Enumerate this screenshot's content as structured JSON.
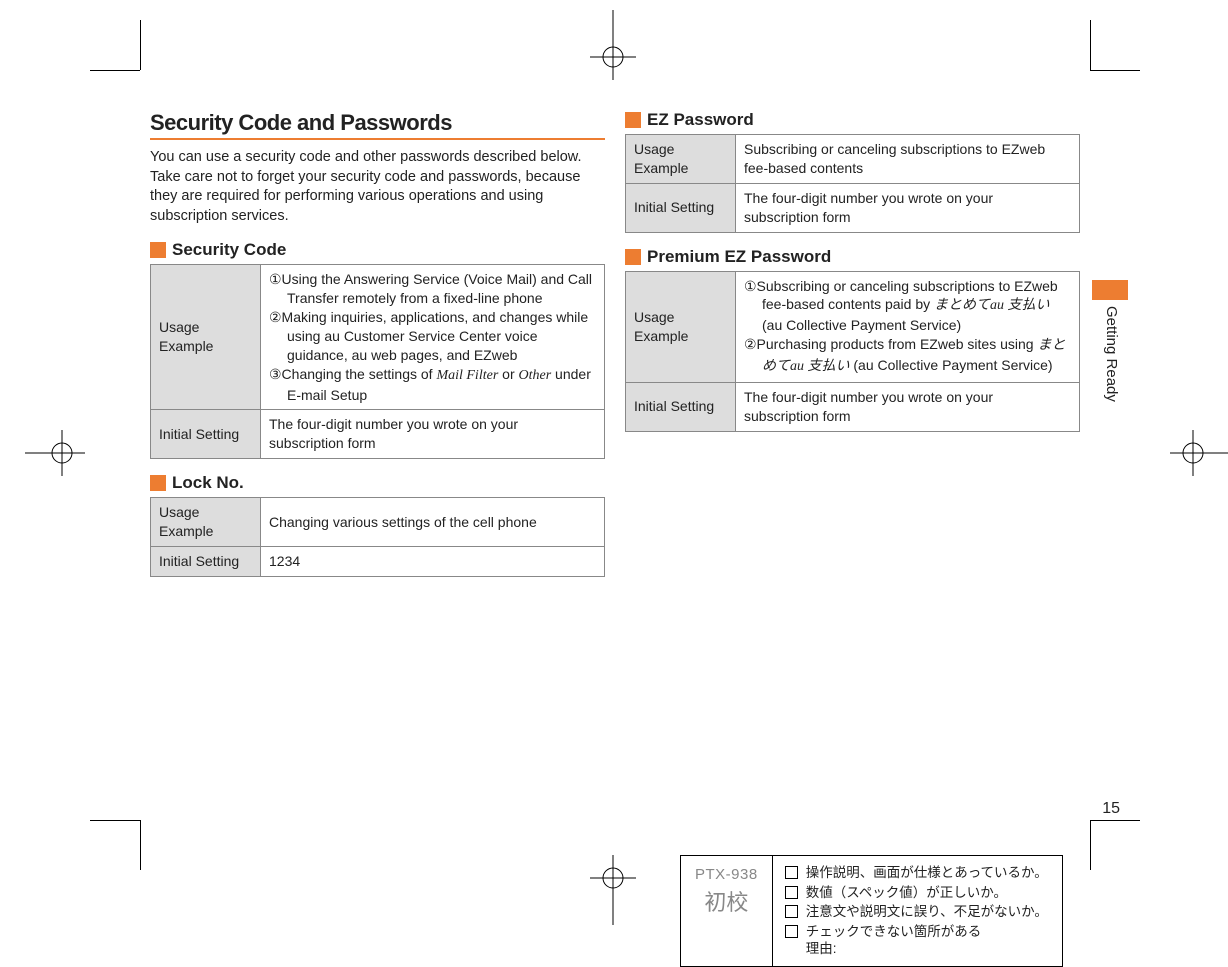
{
  "heading": "Security Code and Passwords",
  "intro": "You can use a security code and other passwords described below.\nTake care not to forget your security code and passwords, because they are required for performing various operations and using subscription services.",
  "sections": {
    "securityCode": {
      "title": "Security Code",
      "rows": {
        "usageLabel": "Usage Example",
        "usage1": "①Using the Answering Service (Voice Mail) and Call Transfer remotely from a fixed-line phone",
        "usage2": "②Making inquiries, applications, and changes while using au Customer Service Center voice guidance, au web pages, and EZweb",
        "usage3a": "③Changing the settings of ",
        "usage3b": "Mail Filter",
        "usage3c": " or ",
        "usage3d": "Other",
        "usage3e": " under E-mail Setup",
        "initLabel": "Initial Setting",
        "initVal": "The four-digit number you wrote on your subscription form"
      }
    },
    "lockNo": {
      "title": "Lock No.",
      "rows": {
        "usageLabel": "Usage Example",
        "usageVal": "Changing various settings of the cell phone",
        "initLabel": "Initial Setting",
        "initVal": "1234"
      }
    },
    "ezPassword": {
      "title": "EZ Password",
      "rows": {
        "usageLabel": "Usage Example",
        "usageVal": "Subscribing or canceling subscriptions to EZweb fee-based contents",
        "initLabel": "Initial Setting",
        "initVal": "The four-digit number you wrote on your subscription form"
      }
    },
    "premiumEz": {
      "title": "Premium EZ Password",
      "rows": {
        "usageLabel": "Usage Example",
        "usage1a": "①Subscribing or canceling subscriptions to EZweb fee-based contents paid by ",
        "usage1b": "まとめて",
        "usage1c": "au",
        "usage1d": " 支払い",
        "usage1e": " (au Collective Payment Service)",
        "usage2a": "②Purchasing products from EZweb sites using ",
        "usage2b": "まとめて",
        "usage2c": "au",
        "usage2d": " 支払い",
        "usage2e": " (au Collective Payment Service)",
        "initLabel": "Initial Setting",
        "initVal": "The four-digit number you wrote on your subscription form"
      }
    }
  },
  "sideTab": "Getting Ready",
  "pageNum": "15",
  "footer": {
    "code": "PTX-938",
    "proof": "初校",
    "checks": {
      "c1": "操作説明、画面が仕様とあっているか。",
      "c2": "数値（スペック値）が正しいか。",
      "c3": "注意文や説明文に誤り、不足がないか。",
      "c4a": "チェックできない箇所がある",
      "c4b": "理由:"
    }
  }
}
